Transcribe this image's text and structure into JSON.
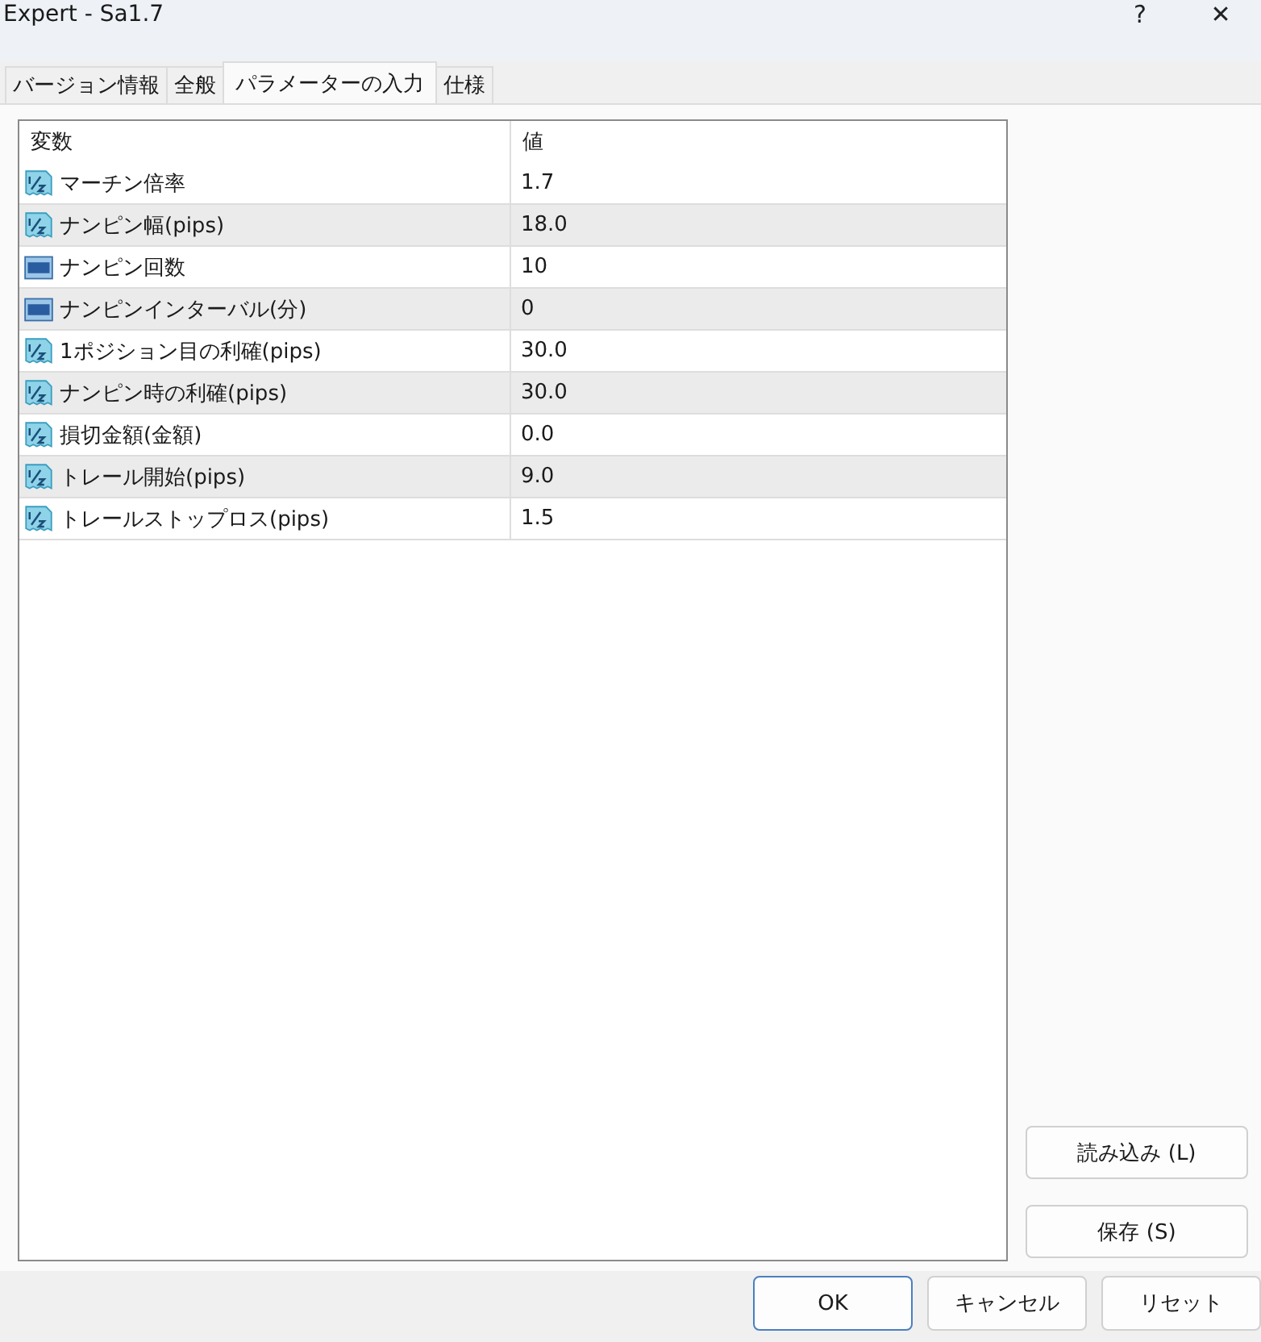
{
  "window": {
    "title": "Expert - Sa1.7",
    "help": "?",
    "close": "✕"
  },
  "tabs": [
    {
      "label": "バージョン情報",
      "selected": false
    },
    {
      "label": "全般",
      "selected": false
    },
    {
      "label": "パラメーターの入力",
      "selected": true
    },
    {
      "label": "仕様",
      "selected": false
    }
  ],
  "table": {
    "columns": [
      "変数",
      "値"
    ],
    "rows": [
      {
        "kind": "double",
        "name": "マーチン倍率",
        "value": "1.7"
      },
      {
        "kind": "double",
        "name": "ナンピン幅(pips)",
        "value": "18.0"
      },
      {
        "kind": "int",
        "name": "ナンピン回数",
        "value": "10"
      },
      {
        "kind": "int",
        "name": "ナンピンインターバル(分)",
        "value": "0"
      },
      {
        "kind": "double",
        "name": "1ポジション目の利確(pips)",
        "value": "30.0"
      },
      {
        "kind": "double",
        "name": "ナンピン時の利確(pips)",
        "value": "30.0"
      },
      {
        "kind": "double",
        "name": "損切金額(金額)",
        "value": "0.0"
      },
      {
        "kind": "double",
        "name": "トレール開始(pips)",
        "value": "9.0"
      },
      {
        "kind": "double",
        "name": "トレールストップロス(pips)",
        "value": "1.5"
      }
    ]
  },
  "side_buttons": [
    "読み込み (L)",
    "保存 (S)"
  ],
  "buttons": [
    "OK",
    "キャンセル",
    "リセット"
  ]
}
